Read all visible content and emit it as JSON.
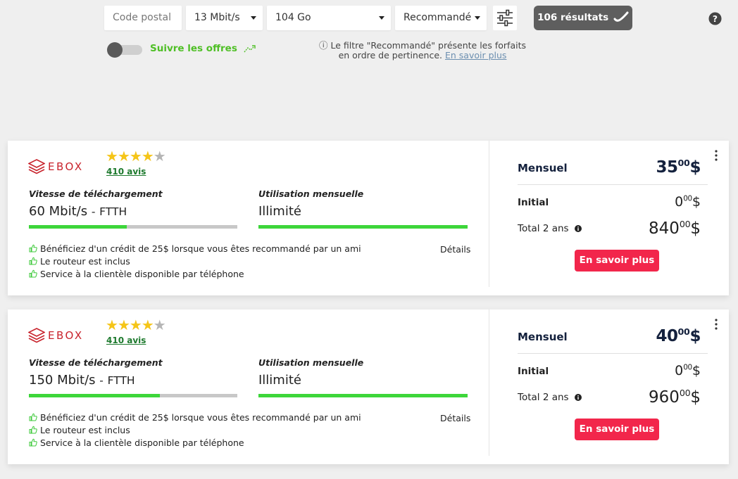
{
  "filters": {
    "postal_placeholder": "Code postal",
    "speed": "13 Mbit/s",
    "data": "104 Go",
    "sort": "Recommandé",
    "results_label": "106 résultats"
  },
  "follow": {
    "label": "Suivre les offres"
  },
  "note": {
    "line1": "ⓘ Le filtre \"Recommandé\" présente les forfaits",
    "line2": "en ordre de pertinence.",
    "link": "En savoir plus"
  },
  "colors": {
    "accent_green": "#4fbf26",
    "cta_red": "#f2264b",
    "brand_red": "#c8232c",
    "navy": "#14213d"
  },
  "offers": [
    {
      "brand": "EBOX",
      "rating": 4,
      "rating_max": 5,
      "reviews": "410 avis",
      "speed_title": "Vitesse de téléchargement",
      "speed_value": "60 Mbit/s",
      "speed_sep": "-",
      "speed_tech": "FTTH",
      "speed_fill": 0.47,
      "usage_title": "Utilisation mensuelle",
      "usage_value": "Illimité",
      "usage_fill": 1.0,
      "features": [
        "Bénéficiez d'un crédit de 25$ lorsque vous êtes recommandé par un ami",
        "Le routeur est inclus",
        "Service à la clientèle disponible par téléphone"
      ],
      "details": "Détails",
      "monthly_label": "Mensuel",
      "monthly_int": "35",
      "monthly_dec": "00",
      "initial_label": "Initial",
      "initial_int": "0",
      "initial_dec": "00",
      "total_label": "Total 2 ans",
      "total_int": "840",
      "total_dec": "00",
      "currency": "$",
      "cta": "En savoir plus"
    },
    {
      "brand": "EBOX",
      "rating": 4,
      "rating_max": 5,
      "reviews": "410 avis",
      "speed_title": "Vitesse de téléchargement",
      "speed_value": "150 Mbit/s",
      "speed_sep": "-",
      "speed_tech": "FTTH",
      "speed_fill": 0.63,
      "usage_title": "Utilisation mensuelle",
      "usage_value": "Illimité",
      "usage_fill": 1.0,
      "features": [
        "Bénéficiez d'un crédit de 25$ lorsque vous êtes recommandé par un ami",
        "Le routeur est inclus",
        "Service à la clientèle disponible par téléphone"
      ],
      "details": "Détails",
      "monthly_label": "Mensuel",
      "monthly_int": "40",
      "monthly_dec": "00",
      "initial_label": "Initial",
      "initial_int": "0",
      "initial_dec": "00",
      "total_label": "Total 2 ans",
      "total_int": "960",
      "total_dec": "00",
      "currency": "$",
      "cta": "En savoir plus"
    }
  ]
}
